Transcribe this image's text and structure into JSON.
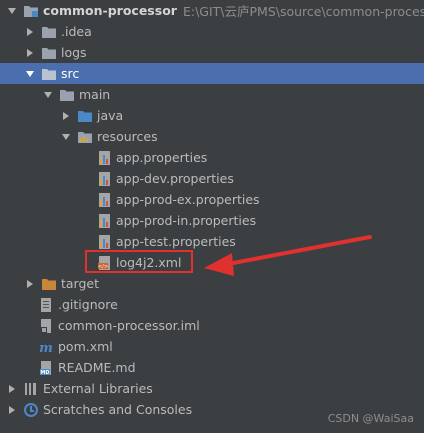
{
  "project": {
    "name": "common-processor",
    "path": "E:\\GIT\\云庐PMS\\source\\common-processor"
  },
  "tree": {
    "idea": ".idea",
    "logs": "logs",
    "src": "src",
    "main": "main",
    "java": "java",
    "resources": "resources",
    "files": [
      "app.properties",
      "app-dev.properties",
      "app-prod-ex.properties",
      "app-prod-in.properties",
      "app-test.properties"
    ],
    "log4j2": "log4j2.xml",
    "target": "target",
    "gitignore": ".gitignore",
    "iml": "common-processor.iml",
    "pom": "pom.xml",
    "readme": "README.md",
    "external": "External Libraries",
    "scratches": "Scratches and Consoles"
  },
  "watermark": "CSDN @WaiSaa",
  "colors": {
    "background": "#3c3f41",
    "selection": "#4b6eaf",
    "folder": "#9aa3ad",
    "annotation": "#e0312e"
  }
}
